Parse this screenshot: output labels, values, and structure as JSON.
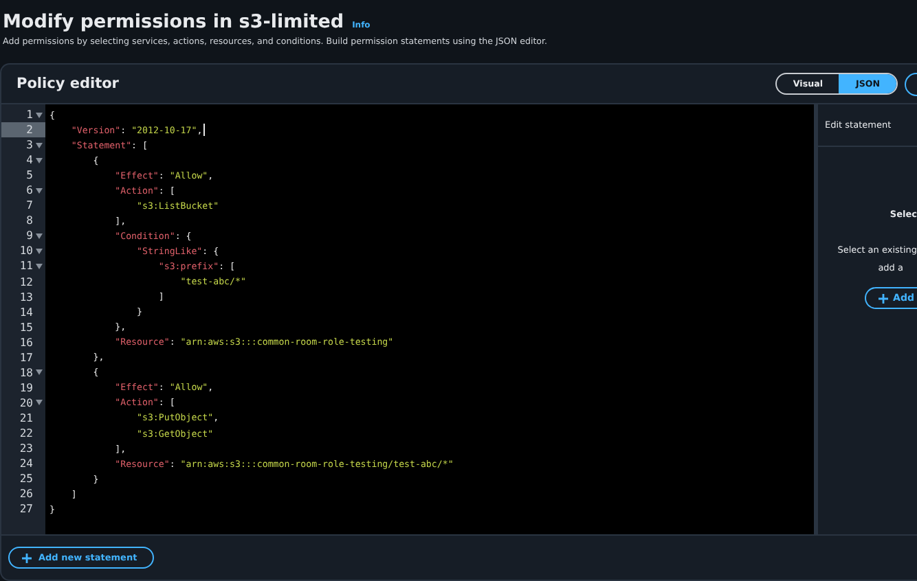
{
  "page": {
    "title": "Modify permissions in s3-limited",
    "info_link": "Info",
    "description": "Add permissions by selecting services, actions, resources, and conditions. Build permission statements using the JSON editor."
  },
  "policy_editor": {
    "title": "Policy editor",
    "mode_toggle": [
      {
        "label": "Visual",
        "selected": false
      },
      {
        "label": "JSON",
        "selected": true
      }
    ],
    "code_lines": [
      {
        "number": "1",
        "foldable": true,
        "selected": false,
        "tokens": [
          {
            "kind": "punct",
            "text": "{"
          }
        ]
      },
      {
        "number": "2",
        "foldable": false,
        "selected": true,
        "tokens": [
          {
            "kind": "key",
            "text": "    \"Version\""
          },
          {
            "kind": "punct",
            "text": ": "
          },
          {
            "kind": "string",
            "text": "\"2012-10-17\""
          },
          {
            "kind": "punct",
            "text": ","
          }
        ]
      },
      {
        "number": "3",
        "foldable": true,
        "selected": false,
        "tokens": [
          {
            "kind": "key",
            "text": "    \"Statement\""
          },
          {
            "kind": "punct",
            "text": ": ["
          }
        ]
      },
      {
        "number": "4",
        "foldable": true,
        "selected": false,
        "tokens": [
          {
            "kind": "punct",
            "text": "        {"
          }
        ]
      },
      {
        "number": "5",
        "foldable": false,
        "selected": false,
        "tokens": [
          {
            "kind": "key",
            "text": "            \"Effect\""
          },
          {
            "kind": "punct",
            "text": ": "
          },
          {
            "kind": "string",
            "text": "\"Allow\""
          },
          {
            "kind": "punct",
            "text": ","
          }
        ]
      },
      {
        "number": "6",
        "foldable": true,
        "selected": false,
        "tokens": [
          {
            "kind": "key",
            "text": "            \"Action\""
          },
          {
            "kind": "punct",
            "text": ": ["
          }
        ]
      },
      {
        "number": "7",
        "foldable": false,
        "selected": false,
        "tokens": [
          {
            "kind": "string",
            "text": "                \"s3:ListBucket\""
          }
        ]
      },
      {
        "number": "8",
        "foldable": false,
        "selected": false,
        "tokens": [
          {
            "kind": "punct",
            "text": "            ],"
          }
        ]
      },
      {
        "number": "9",
        "foldable": true,
        "selected": false,
        "tokens": [
          {
            "kind": "key",
            "text": "            \"Condition\""
          },
          {
            "kind": "punct",
            "text": ": {"
          }
        ]
      },
      {
        "number": "10",
        "foldable": true,
        "selected": false,
        "tokens": [
          {
            "kind": "key",
            "text": "                \"StringLike\""
          },
          {
            "kind": "punct",
            "text": ": {"
          }
        ]
      },
      {
        "number": "11",
        "foldable": true,
        "selected": false,
        "tokens": [
          {
            "kind": "key",
            "text": "                    \"s3:prefix\""
          },
          {
            "kind": "punct",
            "text": ": ["
          }
        ]
      },
      {
        "number": "12",
        "foldable": false,
        "selected": false,
        "tokens": [
          {
            "kind": "string",
            "text": "                        \"test-abc/*\""
          }
        ]
      },
      {
        "number": "13",
        "foldable": false,
        "selected": false,
        "tokens": [
          {
            "kind": "punct",
            "text": "                    ]"
          }
        ]
      },
      {
        "number": "14",
        "foldable": false,
        "selected": false,
        "tokens": [
          {
            "kind": "punct",
            "text": "                }"
          }
        ]
      },
      {
        "number": "15",
        "foldable": false,
        "selected": false,
        "tokens": [
          {
            "kind": "punct",
            "text": "            },"
          }
        ]
      },
      {
        "number": "16",
        "foldable": false,
        "selected": false,
        "tokens": [
          {
            "kind": "key",
            "text": "            \"Resource\""
          },
          {
            "kind": "punct",
            "text": ": "
          },
          {
            "kind": "string",
            "text": "\"arn:aws:s3:::common-room-role-testing\""
          }
        ]
      },
      {
        "number": "17",
        "foldable": false,
        "selected": false,
        "tokens": [
          {
            "kind": "punct",
            "text": "        },"
          }
        ]
      },
      {
        "number": "18",
        "foldable": true,
        "selected": false,
        "tokens": [
          {
            "kind": "punct",
            "text": "        {"
          }
        ]
      },
      {
        "number": "19",
        "foldable": false,
        "selected": false,
        "tokens": [
          {
            "kind": "key",
            "text": "            \"Effect\""
          },
          {
            "kind": "punct",
            "text": ": "
          },
          {
            "kind": "string",
            "text": "\"Allow\""
          },
          {
            "kind": "punct",
            "text": ","
          }
        ]
      },
      {
        "number": "20",
        "foldable": true,
        "selected": false,
        "tokens": [
          {
            "kind": "key",
            "text": "            \"Action\""
          },
          {
            "kind": "punct",
            "text": ": ["
          }
        ]
      },
      {
        "number": "21",
        "foldable": false,
        "selected": false,
        "tokens": [
          {
            "kind": "string",
            "text": "                \"s3:PutObject\""
          },
          {
            "kind": "punct",
            "text": ","
          }
        ]
      },
      {
        "number": "22",
        "foldable": false,
        "selected": false,
        "tokens": [
          {
            "kind": "string",
            "text": "                \"s3:GetObject\""
          }
        ]
      },
      {
        "number": "23",
        "foldable": false,
        "selected": false,
        "tokens": [
          {
            "kind": "punct",
            "text": "            ],"
          }
        ]
      },
      {
        "number": "24",
        "foldable": false,
        "selected": false,
        "tokens": [
          {
            "kind": "key",
            "text": "            \"Resource\""
          },
          {
            "kind": "punct",
            "text": ": "
          },
          {
            "kind": "string",
            "text": "\"arn:aws:s3:::common-room-role-testing/test-abc/*\""
          }
        ]
      },
      {
        "number": "25",
        "foldable": false,
        "selected": false,
        "tokens": [
          {
            "kind": "punct",
            "text": "        }"
          }
        ]
      },
      {
        "number": "26",
        "foldable": false,
        "selected": false,
        "tokens": [
          {
            "kind": "punct",
            "text": "    ]"
          }
        ]
      },
      {
        "number": "27",
        "foldable": false,
        "selected": false,
        "tokens": [
          {
            "kind": "punct",
            "text": "}"
          }
        ]
      }
    ],
    "add_statement_button": "Add new statement",
    "side_panel": {
      "title": "Edit statement",
      "heading": "Selec",
      "text_lines": [
        "Select an existing",
        "add a"
      ],
      "add_button": "Add"
    }
  }
}
